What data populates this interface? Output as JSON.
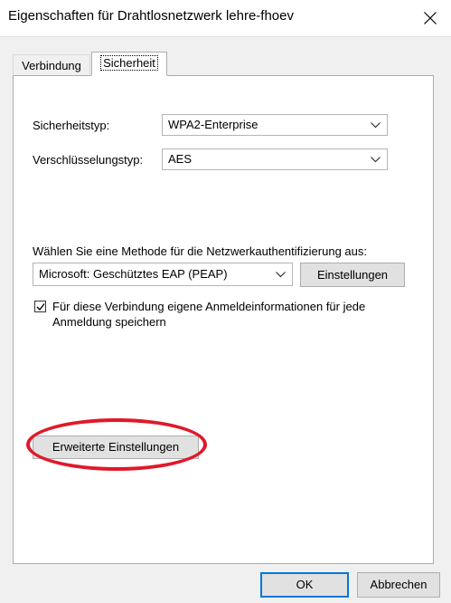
{
  "window": {
    "title": "Eigenschaften für Drahtlosnetzwerk lehre-fhoev"
  },
  "tabs": [
    {
      "label": "Verbindung",
      "selected": false
    },
    {
      "label": "Sicherheit",
      "selected": true
    }
  ],
  "security": {
    "security_type_label": "Sicherheitstyp:",
    "security_type_value": "WPA2-Enterprise",
    "encryption_type_label": "Verschlüsselungstyp:",
    "encryption_type_value": "AES",
    "method_label": "Wählen Sie eine Methode für die Netzwerkauthentifizierung aus:",
    "method_value": "Microsoft: Geschütztes EAP (PEAP)",
    "settings_button_label": "Einstellungen",
    "remember_checkbox_checked": true,
    "remember_checkbox_label": "Für diese Verbindung eigene Anmeldeinformationen für jede Anmeldung speichern",
    "advanced_button_label": "Erweiterte Einstellungen"
  },
  "footer": {
    "ok_label": "OK",
    "cancel_label": "Abbrechen"
  },
  "colors": {
    "highlight_ellipse": "#e0192a",
    "ok_button_border": "#0078d7"
  },
  "icons": [
    "close-icon",
    "chevron-down-icon",
    "checkmark-icon"
  ]
}
